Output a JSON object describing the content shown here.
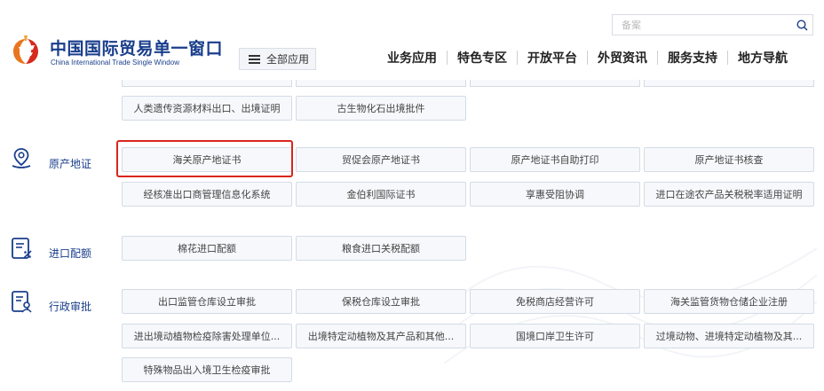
{
  "header": {
    "logo_cn": "中国国际贸易单一窗口",
    "logo_en": "China International Trade Single Window",
    "all_apps_label": "全部应用",
    "search_placeholder": "备案",
    "nav": [
      "业务应用",
      "特色专区",
      "开放平台",
      "外贸资讯",
      "服务支持",
      "地方导航"
    ]
  },
  "colors": {
    "brand_blue": "#1a3e8c",
    "highlight_red": "#d9261c",
    "button_bg": "#f6f8fb",
    "button_border": "#d4dbe6",
    "logo_orange": "#e8761e",
    "logo_red": "#d62a1e"
  },
  "top_section": {
    "items": [
      "人类遗传资源材料出口、出境证明",
      "古生物化石出境批件"
    ]
  },
  "sections": [
    {
      "title": "原产地证",
      "icon": "location-pin-icon",
      "items": [
        "海关原产地证书",
        "贸促会原产地证书",
        "原产地证书自助打印",
        "原产地证书核查",
        "经核准出口商管理信息化系统",
        "金伯利国际证书",
        "享惠受阻协调",
        "进口在途农产品关税税率适用证明"
      ]
    },
    {
      "title": "进口配额",
      "icon": "quota-document-icon",
      "items": [
        "棉花进口配额",
        "粮食进口关税配额"
      ]
    },
    {
      "title": "行政审批",
      "icon": "approval-document-icon",
      "items": [
        "出口监管仓库设立审批",
        "保税仓库设立审批",
        "免税商店经营许可",
        "海关监管货物仓储企业注册",
        "进出境动植物检疫除害处理单位...",
        "出境特定动植物及其产品和其他...",
        "国境口岸卫生许可",
        "过境动物、进境特定动植物及其...",
        "特殊物品出入境卫生检疫审批"
      ]
    }
  ]
}
